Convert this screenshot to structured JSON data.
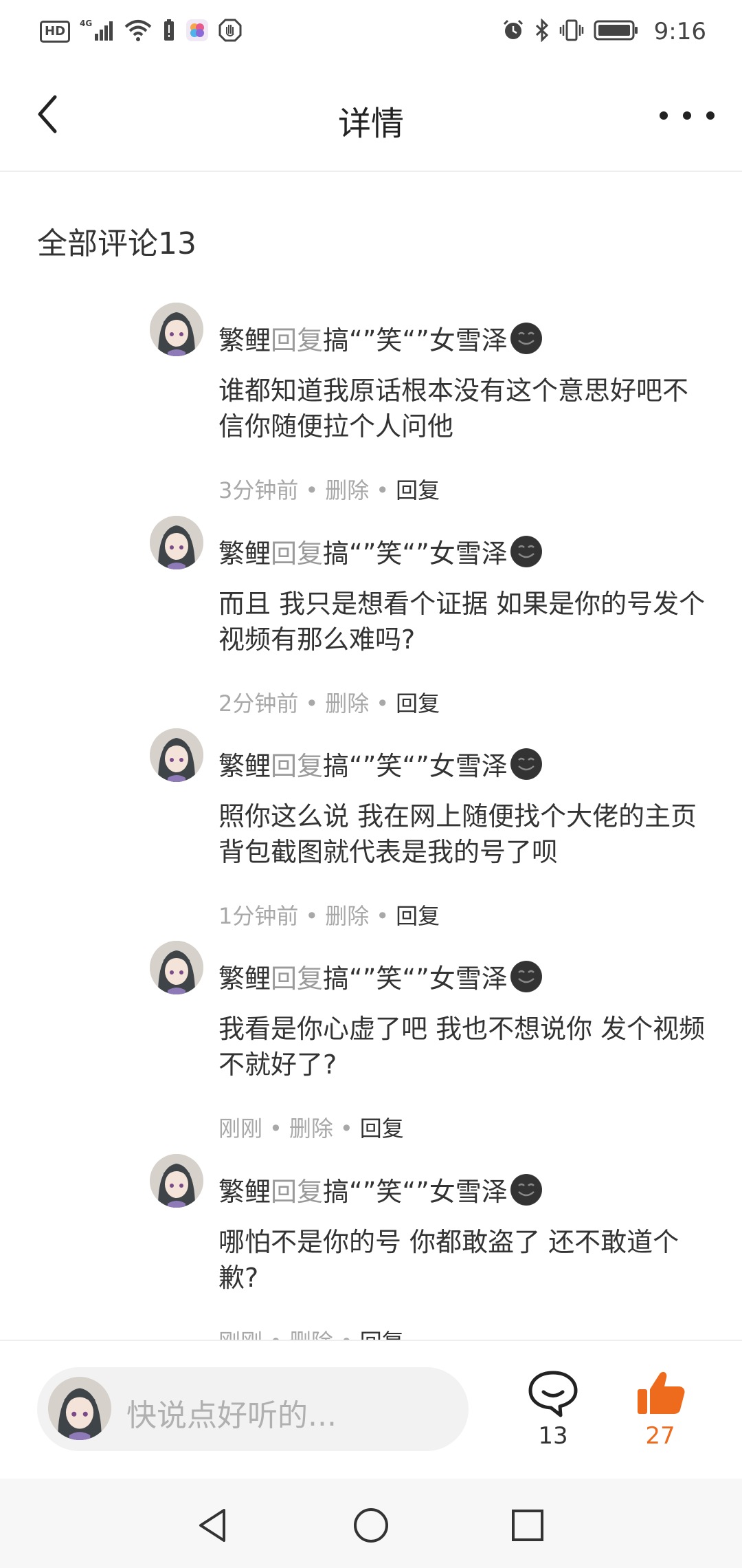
{
  "status_bar": {
    "hd": "HD",
    "network": "4G",
    "time": "9:16",
    "icons": [
      "hd-icon",
      "signal-icon",
      "wifi-icon",
      "battery-alert-icon",
      "app-icon",
      "hand-icon",
      "alarm-icon",
      "bluetooth-icon",
      "vibrate-icon",
      "battery-icon"
    ]
  },
  "header": {
    "title": "详情",
    "back_icon": "back-arrow-icon",
    "more_icon": "more-dots-icon"
  },
  "section": {
    "title": "全部评论13"
  },
  "comments": [
    {
      "author": "繁鲤",
      "reply_word": "回复",
      "target": "搞“”笑“”女雪泽",
      "text": "谁都知道我原话根本没有这个意思好吧不信你随便拉个人问他",
      "time": "3分钟前",
      "delete": "删除",
      "reply": "回复"
    },
    {
      "author": "繁鲤",
      "reply_word": "回复",
      "target": "搞“”笑“”女雪泽",
      "text": "而且 我只是想看个证据 如果是你的号发个视频有那么难吗?",
      "time": "2分钟前",
      "delete": "删除",
      "reply": "回复"
    },
    {
      "author": "繁鲤",
      "reply_word": "回复",
      "target": "搞“”笑“”女雪泽",
      "text": "照你这么说 我在网上随便找个大佬的主页 背包截图就代表是我的号了呗",
      "time": "1分钟前",
      "delete": "删除",
      "reply": "回复"
    },
    {
      "author": "繁鲤",
      "reply_word": "回复",
      "target": "搞“”笑“”女雪泽",
      "text": "我看是你心虚了吧 我也不想说你 发个视频不就好了?",
      "time": "刚刚",
      "delete": "删除",
      "reply": "回复"
    },
    {
      "author": "繁鲤",
      "reply_word": "回复",
      "target": "搞“”笑“”女雪泽",
      "text": "哪怕不是你的号 你都敢盗了 还不敢道个歉?",
      "time": "刚刚",
      "delete": "删除",
      "reply": "回复"
    }
  ],
  "bottom_bar": {
    "placeholder": "快说点好听的...",
    "comment_count": "13",
    "like_count": "27",
    "like_color": "#ee6b1e"
  },
  "nav_bar": {
    "icons": [
      "nav-back-icon",
      "nav-home-icon",
      "nav-recents-icon"
    ]
  }
}
